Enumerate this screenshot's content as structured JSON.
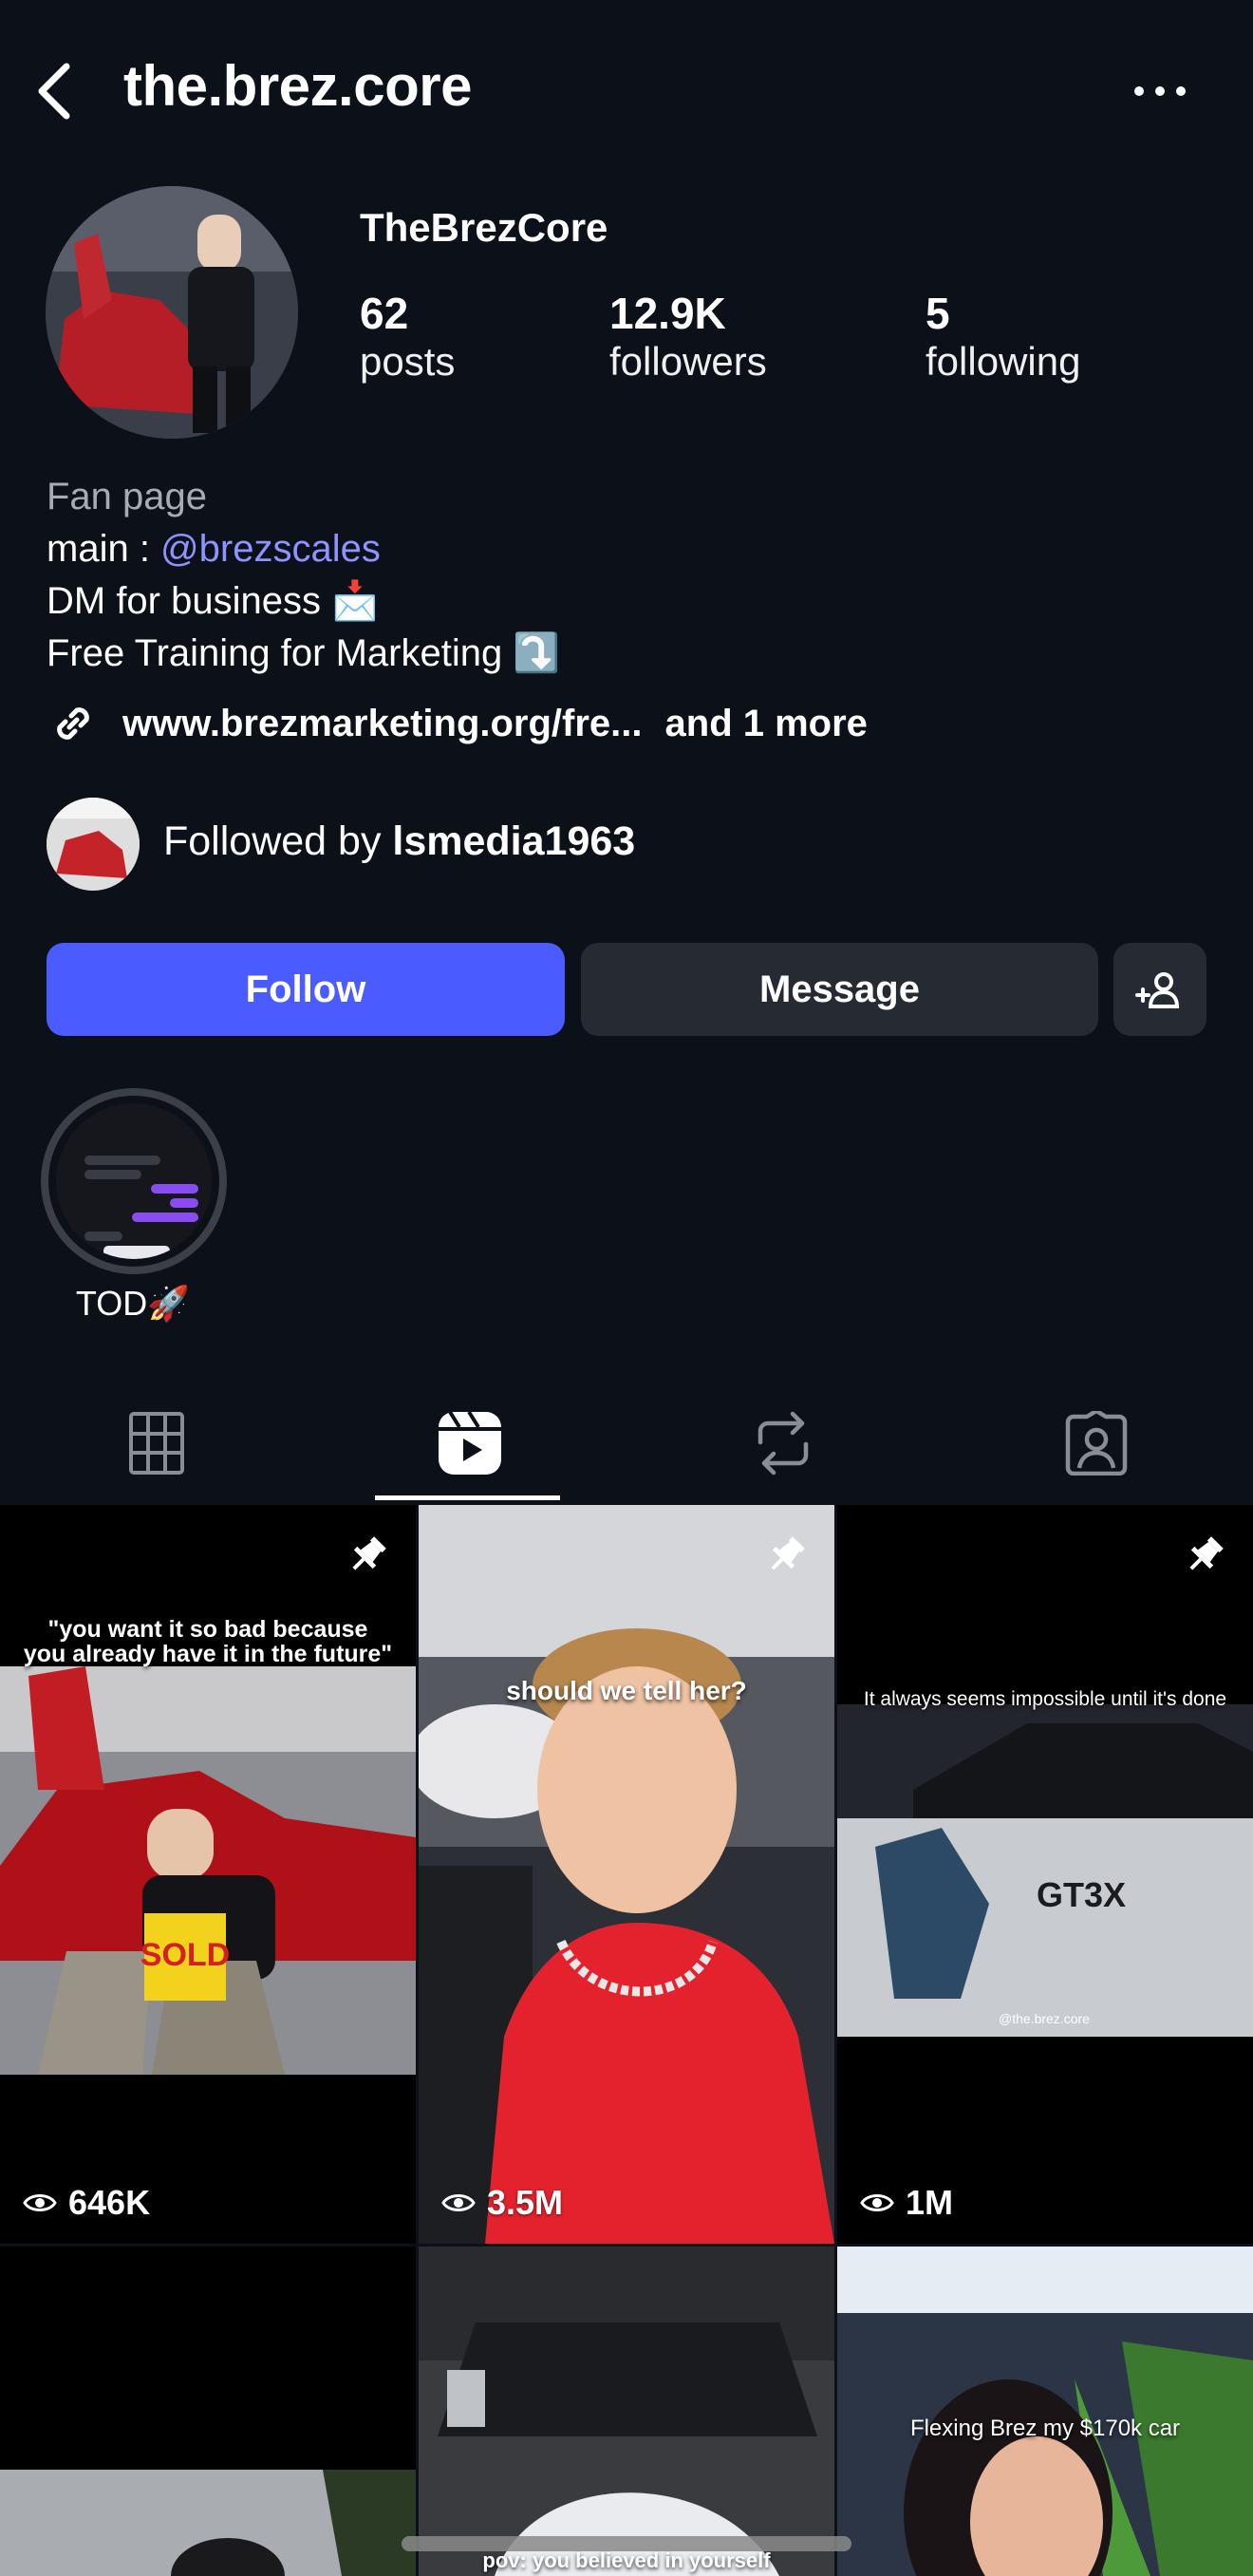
{
  "header": {
    "username": "the.brez.core"
  },
  "profile": {
    "display_name": "TheBrezCore",
    "stats": [
      {
        "value": "62",
        "label": "posts"
      },
      {
        "value": "12.9K",
        "label": "followers"
      },
      {
        "value": "5",
        "label": "following"
      }
    ],
    "bio": {
      "category": "Fan page",
      "line2_prefix": "main : ",
      "mention": "@brezscales",
      "line3": "DM for business 📩",
      "line4": "Free Training for Marketing ⤵️"
    },
    "link": {
      "url": "www.brezmarketing.org/fre...",
      "more": "and 1 more"
    },
    "followed_by": {
      "prefix": "Followed by ",
      "name": "lsmedia1963"
    }
  },
  "actions": {
    "follow_label": "Follow",
    "message_label": "Message"
  },
  "highlights": [
    {
      "label": "TOD🚀"
    }
  ],
  "tabs": [
    {
      "name": "grid",
      "icon": "grid-icon",
      "active": false
    },
    {
      "name": "reels",
      "icon": "reels-icon",
      "active": true
    },
    {
      "name": "reposts",
      "icon": "repost-icon",
      "active": false
    },
    {
      "name": "tagged",
      "icon": "tagged-icon",
      "active": false
    }
  ],
  "grid": [
    {
      "caption": "\"you want it so bad because\nyou already have it in the future\"",
      "views": "646K",
      "pinned": true
    },
    {
      "caption": "should we tell her?",
      "views": "3.5M",
      "pinned": true
    },
    {
      "caption": "It always seems impossible until it's done",
      "views": "1M",
      "pinned": true,
      "overlay_text": "GT3X",
      "watermark": "@the.brez.core"
    },
    {
      "caption": "",
      "views": "",
      "pinned": false
    },
    {
      "caption": "pov: you believed in yourself",
      "views": "",
      "pinned": false
    },
    {
      "caption": "Flexing Brez my $170k car",
      "views": "",
      "pinned": false
    }
  ],
  "colors": {
    "background": "#0c1019",
    "follow_button": "#4a5cff",
    "secondary_button": "#262a33",
    "mention": "#8d93ff",
    "muted_text": "#a8abb3"
  }
}
